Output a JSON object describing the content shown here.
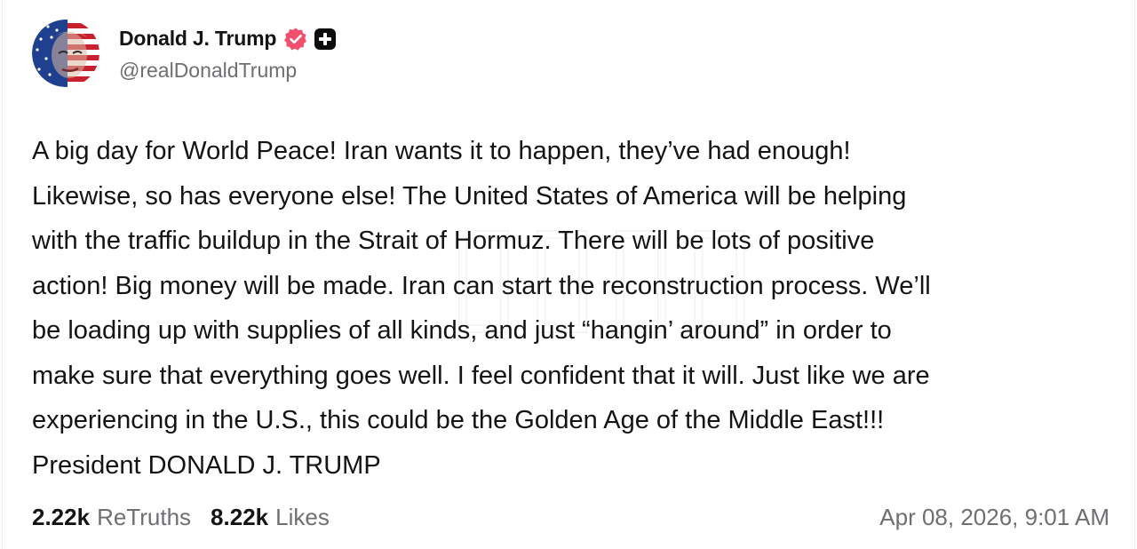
{
  "author": {
    "display_name": "Donald J. Trump",
    "handle": "@realDonaldTrump",
    "verified_icon": "verified-badge-icon",
    "plus_icon": "plus-square-icon",
    "verified_color": "#f0506e"
  },
  "post": {
    "lines": [
      "A big day for World Peace! Iran wants it to happen, they’ve had enough!",
      "Likewise, so has everyone else! The United States of America will be helping",
      "with the traffic buildup in the Strait of Hormuz. There will be lots of positive",
      "action! Big money will be made. Iran can start the reconstruction process. We’ll",
      "be loading up with supplies of all kinds, and just “hangin’ around” in order to",
      "make sure that everything goes well. I feel confident that it will. Just like we are",
      "experiencing in the U.S., this could be the Golden Age of the Middle East!!!",
      "President DONALD J. TRUMP"
    ]
  },
  "stats": {
    "retruths_count": "2.22k",
    "retruths_label": "ReTruths",
    "likes_count": "8.22k",
    "likes_label": "Likes"
  },
  "timestamp": "Apr 08, 2026, 9:01 AM"
}
